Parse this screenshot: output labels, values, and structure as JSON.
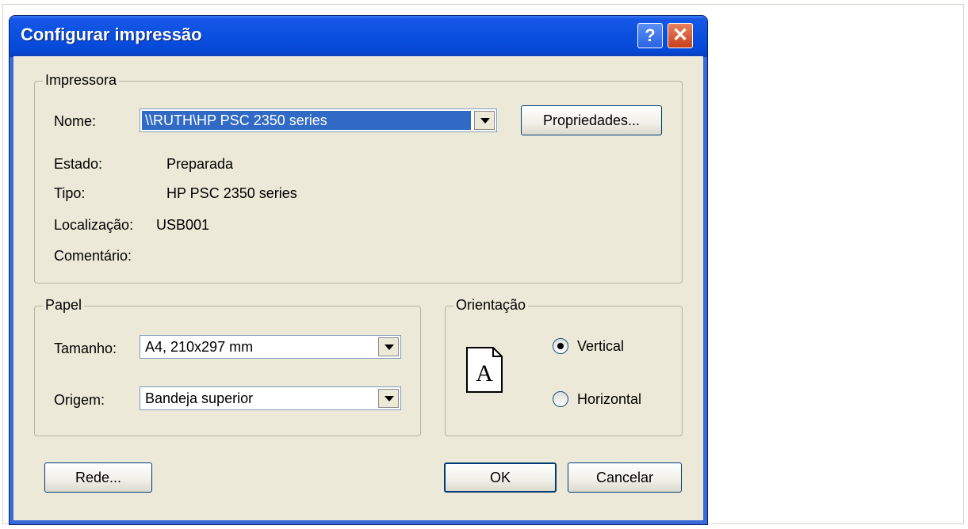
{
  "dialog": {
    "title": "Configurar impressão",
    "help_label": "?",
    "close_label": "✕"
  },
  "printer": {
    "group_label": "Impressora",
    "name_label": "Nome:",
    "name_value": "\\\\RUTH\\HP PSC 2350 series",
    "properties_label": "Propriedades...",
    "status_label": "Estado:",
    "status_value": "Preparada",
    "type_label": "Tipo:",
    "type_value": "HP PSC 2350 series",
    "location_label": "Localização:",
    "location_value": "USB001",
    "comment_label": "Comentário:",
    "comment_value": ""
  },
  "paper": {
    "group_label": "Papel",
    "size_label": "Tamanho:",
    "size_value": "A4, 210x297 mm",
    "source_label": "Origem:",
    "source_value": "Bandeja superior"
  },
  "orientation": {
    "group_label": "Orientação",
    "icon_letter": "A",
    "portrait_label": "Vertical",
    "landscape_label": "Horizontal",
    "selected": "portrait"
  },
  "buttons": {
    "network_label": "Rede...",
    "ok_label": "OK",
    "cancel_label": "Cancelar"
  },
  "colors": {
    "titlebar": "#0a4fe0",
    "client_bg": "#ece9d8",
    "selection": "#316ac5"
  }
}
